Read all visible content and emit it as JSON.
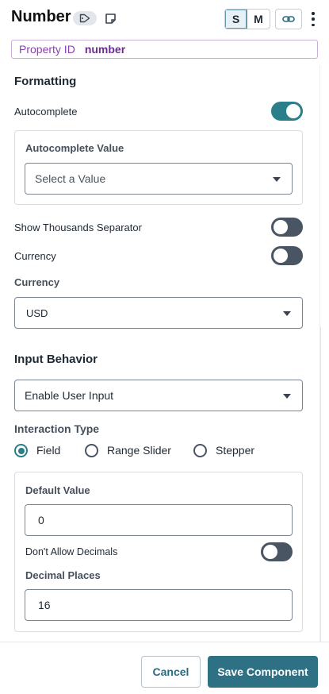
{
  "header": {
    "title": "Number",
    "size_options": [
      "S",
      "M"
    ],
    "selected_size": "S"
  },
  "property": {
    "label": "Property ID",
    "value": "number"
  },
  "formatting": {
    "section_title": "Formatting",
    "autocomplete_label": "Autocomplete",
    "autocomplete_on": true,
    "autocomplete_value_label": "Autocomplete Value",
    "autocomplete_value_placeholder": "Select a Value",
    "thousands_label": "Show Thousands Separator",
    "thousands_on": false,
    "currency_toggle_label": "Currency",
    "currency_on": false,
    "currency_select_label": "Currency",
    "currency_value": "USD"
  },
  "input_behavior": {
    "section_title": "Input Behavior",
    "behavior_value": "Enable User Input",
    "interaction_label": "Interaction Type",
    "interaction_options": [
      "Field",
      "Range Slider",
      "Stepper"
    ],
    "interaction_selected": "Field",
    "default_value_label": "Default Value",
    "default_value": "0",
    "no_decimals_label": "Don't Allow Decimals",
    "no_decimals_on": false,
    "decimal_places_label": "Decimal Places",
    "decimal_places": "16"
  },
  "footer": {
    "cancel_label": "Cancel",
    "save_label": "Save Component"
  },
  "colors": {
    "accent": "#2a7f8a",
    "primary_button": "#2e7185",
    "property_id": "#8a3fb0"
  }
}
